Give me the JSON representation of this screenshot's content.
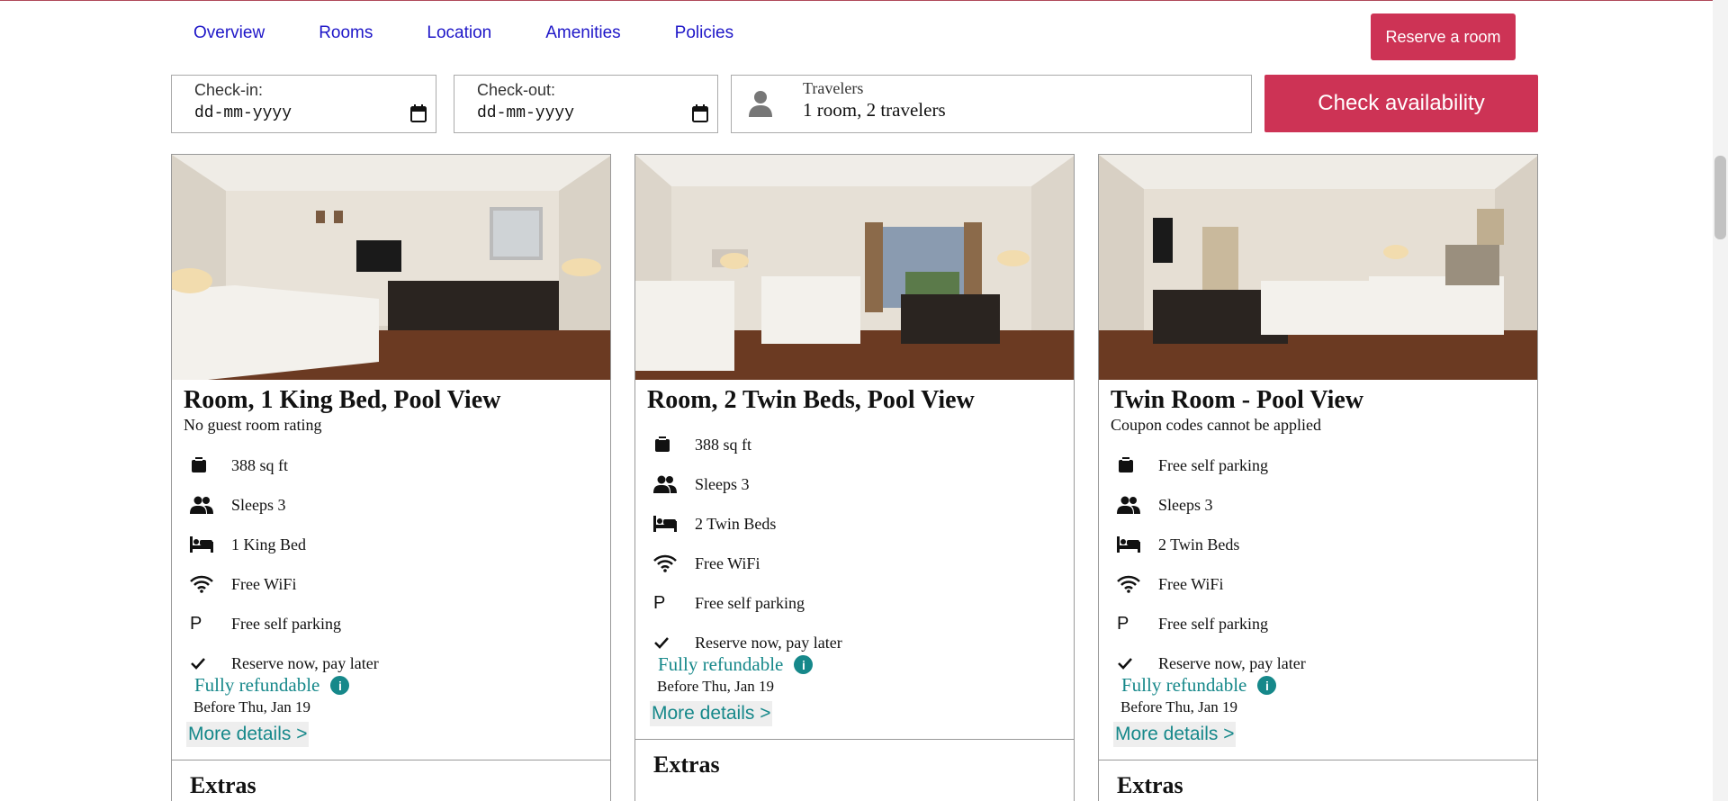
{
  "nav": {
    "links": [
      "Overview",
      "Rooms",
      "Location",
      "Amenities",
      "Policies"
    ],
    "reserve_label": "Reserve a room"
  },
  "search": {
    "checkin_label": "Check-in:",
    "checkin_value": "dd-mm-yyyy",
    "checkout_label": "Check-out:",
    "checkout_value": "dd-mm-yyyy",
    "travelers_label": "Travelers",
    "travelers_value": "1 room, 2 travelers",
    "check_label": "Check availability"
  },
  "colors": {
    "accent": "#cd3355",
    "link": "#1f17c8",
    "teal": "#16888a"
  },
  "rooms": [
    {
      "title": "Room, 1 King Bed, Pool View",
      "subtitle": "No guest room rating",
      "features": [
        {
          "icon": "building-icon",
          "text": "388 sq ft"
        },
        {
          "icon": "people-icon",
          "text": "Sleeps 3"
        },
        {
          "icon": "bed-icon",
          "text": "1 King Bed"
        },
        {
          "icon": "wifi-icon",
          "text": "Free WiFi"
        },
        {
          "icon": "parking-icon",
          "text": "Free self parking"
        },
        {
          "icon": "check-icon",
          "text": "Reserve now, pay later"
        }
      ],
      "refundable": "Fully refundable",
      "before": "Before Thu, Jan 19",
      "more": "More details >",
      "extras": "Extras"
    },
    {
      "title": "Room, 2 Twin Beds, Pool View",
      "subtitle": "",
      "features": [
        {
          "icon": "building-icon",
          "text": "388 sq ft"
        },
        {
          "icon": "people-icon",
          "text": "Sleeps 3"
        },
        {
          "icon": "bed-icon",
          "text": "2 Twin Beds"
        },
        {
          "icon": "wifi-icon",
          "text": "Free WiFi"
        },
        {
          "icon": "parking-icon",
          "text": "Free self parking"
        },
        {
          "icon": "check-icon",
          "text": "Reserve now, pay later"
        }
      ],
      "refundable": "Fully refundable",
      "before": "Before Thu, Jan 19",
      "more": "More details >",
      "extras": "Extras"
    },
    {
      "title": "Twin Room - Pool View",
      "subtitle": "Coupon codes cannot be applied",
      "features": [
        {
          "icon": "building-icon",
          "text": "Free self parking"
        },
        {
          "icon": "people-icon",
          "text": "Sleeps 3"
        },
        {
          "icon": "bed-icon",
          "text": "2 Twin Beds"
        },
        {
          "icon": "wifi-icon",
          "text": "Free WiFi"
        },
        {
          "icon": "parking-icon",
          "text": "Free self parking"
        },
        {
          "icon": "check-icon",
          "text": "Reserve now, pay later"
        }
      ],
      "refundable": "Fully refundable",
      "before": "Before Thu, Jan 19",
      "more": "More details >",
      "extras": "Extras"
    }
  ]
}
